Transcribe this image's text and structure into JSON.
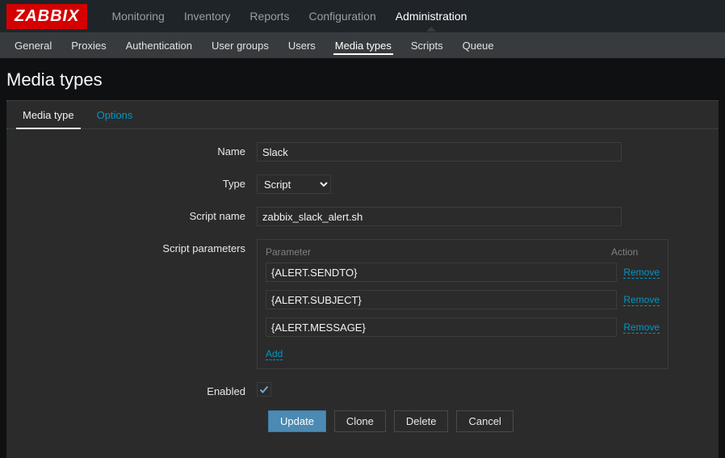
{
  "brand": "ZABBIX",
  "topnav": [
    {
      "label": "Monitoring",
      "active": false
    },
    {
      "label": "Inventory",
      "active": false
    },
    {
      "label": "Reports",
      "active": false
    },
    {
      "label": "Configuration",
      "active": false
    },
    {
      "label": "Administration",
      "active": true
    }
  ],
  "subnav": [
    {
      "label": "General",
      "active": false
    },
    {
      "label": "Proxies",
      "active": false
    },
    {
      "label": "Authentication",
      "active": false
    },
    {
      "label": "User groups",
      "active": false
    },
    {
      "label": "Users",
      "active": false
    },
    {
      "label": "Media types",
      "active": true
    },
    {
      "label": "Scripts",
      "active": false
    },
    {
      "label": "Queue",
      "active": false
    }
  ],
  "page_title": "Media types",
  "tabs": [
    {
      "label": "Media type",
      "active": true
    },
    {
      "label": "Options",
      "active": false
    }
  ],
  "form": {
    "labels": {
      "name": "Name",
      "type": "Type",
      "script_name": "Script name",
      "script_parameters": "Script parameters",
      "enabled": "Enabled"
    },
    "name_value": "Slack",
    "type_value": "Script",
    "script_name_value": "zabbix_slack_alert.sh",
    "param_header": {
      "parameter": "Parameter",
      "action": "Action"
    },
    "parameters": [
      {
        "value": "{ALERT.SENDTO}",
        "action": "Remove"
      },
      {
        "value": "{ALERT.SUBJECT}",
        "action": "Remove"
      },
      {
        "value": "{ALERT.MESSAGE}",
        "action": "Remove"
      }
    ],
    "add_label": "Add",
    "enabled": true
  },
  "buttons": {
    "update": "Update",
    "clone": "Clone",
    "delete": "Delete",
    "cancel": "Cancel"
  }
}
